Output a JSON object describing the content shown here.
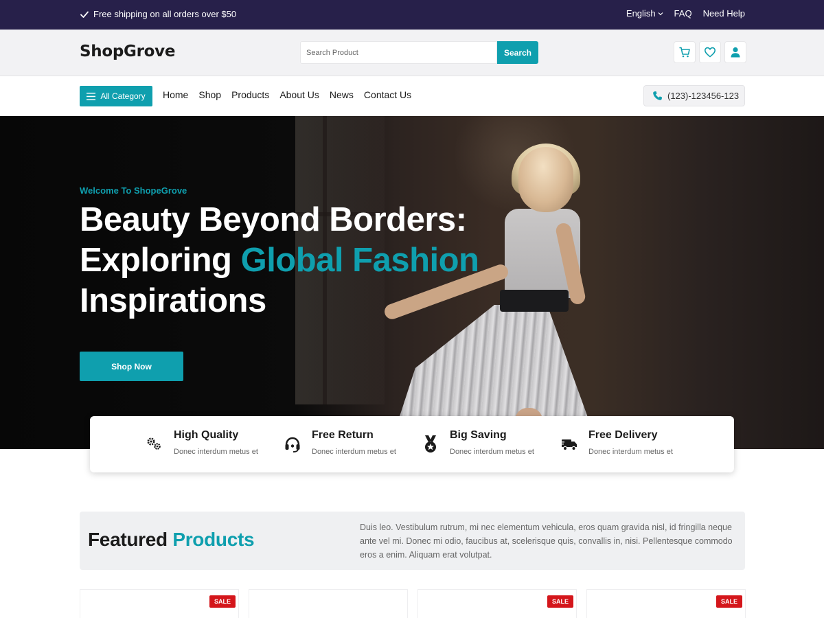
{
  "topbar": {
    "shipping_text": "Free shipping on all orders over $50",
    "language": "English",
    "faq": "FAQ",
    "help": "Need Help"
  },
  "header": {
    "logo": "ShopGrove",
    "search_placeholder": "Search Product",
    "search_button": "Search",
    "icons": [
      "cart-icon",
      "heart-icon",
      "user-icon"
    ]
  },
  "nav": {
    "category_button": "All Category",
    "links": [
      "Home",
      "Shop",
      "Products",
      "About Us",
      "News",
      "Contact Us"
    ],
    "phone": "(123)-123456-123"
  },
  "hero": {
    "welcome": "Welcome To ShopeGrove",
    "line1": "Beauty Beyond Borders:",
    "line2_prefix": "Exploring ",
    "line2_accent": "Global Fashion",
    "line3": "Inspirations",
    "button": "Shop Now"
  },
  "features": [
    {
      "icon": "gears-icon",
      "title": "High Quality",
      "desc": "Donec interdum metus et"
    },
    {
      "icon": "headset-icon",
      "title": "Free Return",
      "desc": "Donec interdum metus et"
    },
    {
      "icon": "medal-icon",
      "title": "Big Saving",
      "desc": "Donec interdum metus et"
    },
    {
      "icon": "truck-icon",
      "title": "Free Delivery",
      "desc": "Donec interdum metus et"
    }
  ],
  "featured": {
    "title_prefix": "Featured ",
    "title_accent": "Products",
    "description": "Duis leo. Vestibulum rutrum, mi nec elementum vehicula, eros quam gravida nisl, id fringilla neque ante vel mi. Donec mi odio, faucibus at, scelerisque quis, convallis in, nisi. Pellentesque commodo eros a enim. Aliquam erat volutpat."
  },
  "products": [
    {
      "badge": "SALE"
    },
    {
      "badge": ""
    },
    {
      "badge": "SALE"
    },
    {
      "badge": "SALE"
    }
  ],
  "colors": {
    "accent": "#0f9fae",
    "topbar": "#27204a",
    "sale": "#d4161b"
  }
}
